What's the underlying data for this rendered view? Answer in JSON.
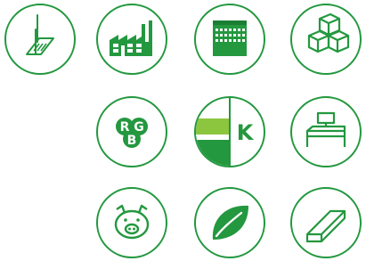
{
  "colors": {
    "green": "#23983f",
    "light_green": "#8cc63f",
    "white": "#ffffff"
  },
  "icons": [
    {
      "name": "surface-treatment-icon"
    },
    {
      "name": "factory-icon"
    },
    {
      "name": "building-icon"
    },
    {
      "name": "boxes-icon"
    },
    {
      "name": "rgb-icon",
      "letters": {
        "r": "R",
        "g": "G",
        "b": "B"
      }
    },
    {
      "name": "cmyk-icon",
      "letter": "K"
    },
    {
      "name": "desk-computer-icon"
    },
    {
      "name": "pig-icon"
    },
    {
      "name": "leaf-icon"
    },
    {
      "name": "angle-profile-icon"
    }
  ]
}
